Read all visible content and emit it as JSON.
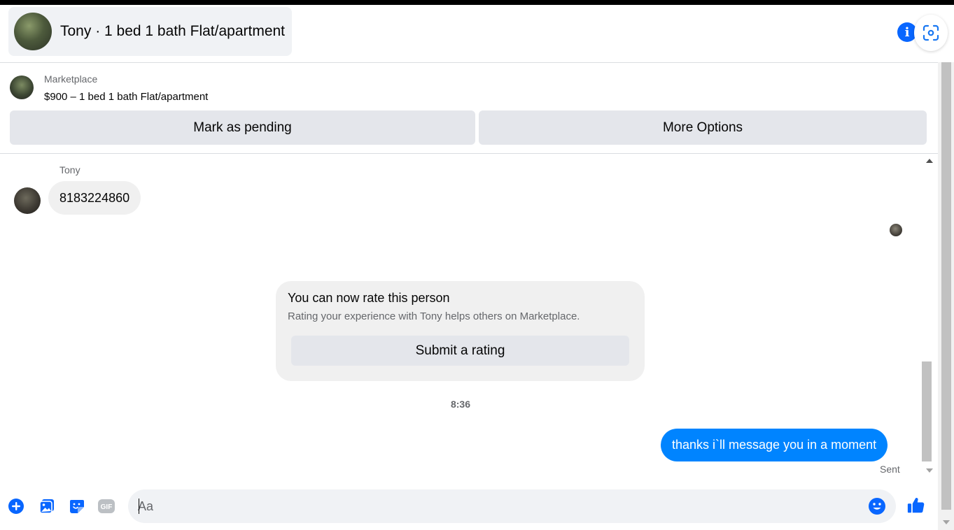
{
  "header": {
    "title": "Tony · 1 bed 1 bath Flat/apartment",
    "info_icon": "info-icon",
    "scan_icon": "screenshot-scan-icon"
  },
  "listing": {
    "source": "Marketplace",
    "title": "$900 – 1 bed 1 bath Flat/apartment",
    "mark_pending_label": "Mark as pending",
    "more_options_label": "More Options"
  },
  "conversation": {
    "sender_name": "Tony",
    "incoming_message": "8183224860",
    "rating_card": {
      "title": "You can now rate this person",
      "subtitle": "Rating your experience with Tony helps others on Marketplace.",
      "button_label": "Submit a rating"
    },
    "timestamp": "8:36",
    "outgoing_message": "thanks i`ll message you in a moment",
    "status": "Sent"
  },
  "composer": {
    "placeholder": "Aa",
    "value": "",
    "icons": [
      "plus-icon",
      "photo-icon",
      "sticker-icon",
      "gif-icon",
      "emoji-icon",
      "thumbs-up-icon"
    ],
    "gif_label": "GIF"
  },
  "colors": {
    "accent": "#0084ff",
    "brand": "#0866ff",
    "bubble_gray": "#f0f0f0",
    "button_gray": "#e4e6eb"
  }
}
